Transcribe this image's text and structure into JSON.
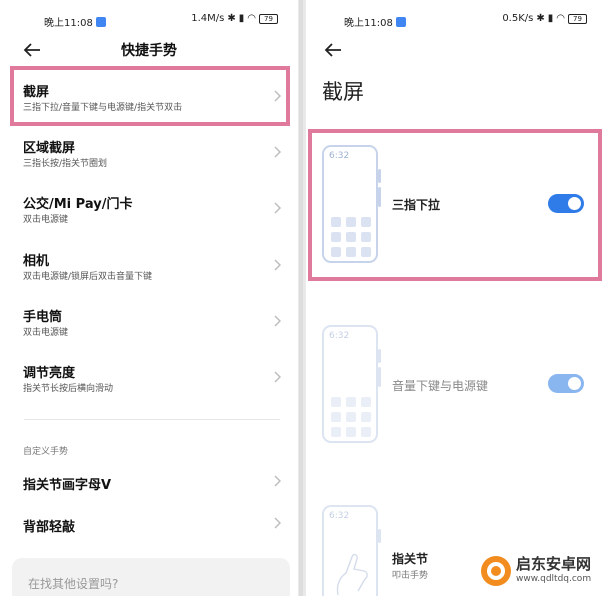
{
  "left": {
    "status": {
      "time": "晚上11:08",
      "speed": "1.4M/s",
      "battery": "79"
    },
    "title": "快捷手势",
    "items": [
      {
        "title": "截屏",
        "subtitle": "三指下拉/音量下键与电源键/指关节双击"
      },
      {
        "title": "区域截屏",
        "subtitle": "三指长按/指关节圈划"
      },
      {
        "title": "公交/Mi Pay/门卡",
        "subtitle": "双击电源键"
      },
      {
        "title": "相机",
        "subtitle": "双击电源键/锁屏后双击音量下键"
      },
      {
        "title": "手电筒",
        "subtitle": "双击电源键"
      },
      {
        "title": "调节亮度",
        "subtitle": "指关节长按后横向滑动"
      }
    ],
    "section": "自定义手势",
    "items2": [
      {
        "title": "指关节画字母V"
      },
      {
        "title": "背部轻敲"
      }
    ],
    "search_placeholder": "在找其他设置吗?"
  },
  "right": {
    "status": {
      "time": "晚上11:08",
      "speed": "0.5K/s",
      "battery": "79"
    },
    "title": "截屏",
    "options": [
      {
        "clock": "6:32",
        "label": "三指下拉",
        "enabled": true
      },
      {
        "clock": "6:32",
        "label": "音量下键与电源键",
        "enabled": true
      },
      {
        "clock": "6:32",
        "label": "指关节",
        "sub": "叩击手势"
      }
    ]
  },
  "watermark": {
    "name": "启东安卓网",
    "url": "www.qdltdq.com"
  },
  "colors": {
    "accent": "#2f7ce8",
    "highlight": "#e07a9c"
  }
}
